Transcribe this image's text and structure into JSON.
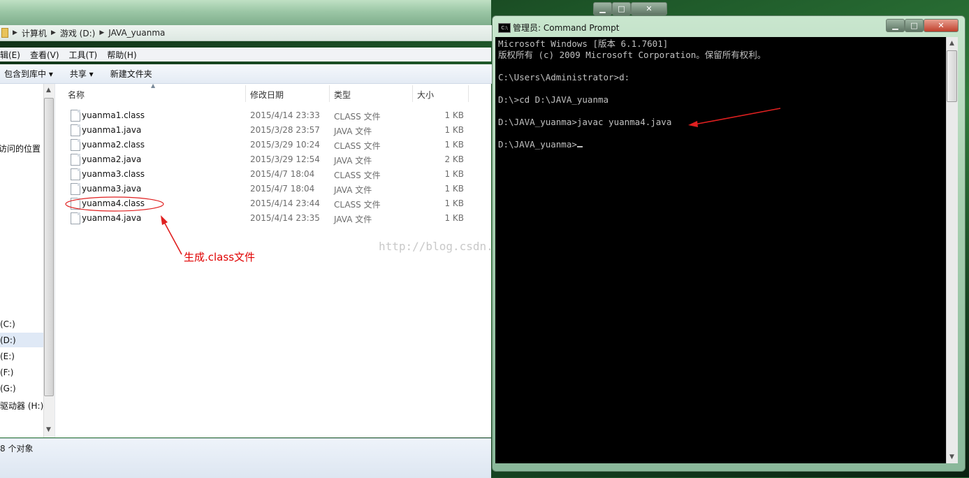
{
  "explorer": {
    "breadcrumb": [
      "计算机",
      "游戏 (D:)",
      "JAVA_yuanma"
    ],
    "menu": [
      "编辑(E)",
      "查看(V)",
      "工具(T)",
      "帮助(H)"
    ],
    "toolbar": [
      "包含到库中 ▾",
      "共享 ▾",
      "新建文件夹"
    ],
    "nav": {
      "recent": "访问的位置",
      "drive_c": "(C:)",
      "drive_d": "(D:)",
      "drive_e": "(E:)",
      "drive_f": "(F:)",
      "drive_g": "(G:)",
      "drive_h": "驱动器 (H:)"
    },
    "columns": {
      "name": "名称",
      "date": "修改日期",
      "type": "类型",
      "size": "大小"
    },
    "files": [
      {
        "name": "yuanma1.class",
        "date": "2015/4/14 23:33",
        "type": "CLASS 文件",
        "size": "1 KB"
      },
      {
        "name": "yuanma1.java",
        "date": "2015/3/28 23:57",
        "type": "JAVA 文件",
        "size": "1 KB"
      },
      {
        "name": "yuanma2.class",
        "date": "2015/3/29 10:24",
        "type": "CLASS 文件",
        "size": "1 KB"
      },
      {
        "name": "yuanma2.java",
        "date": "2015/3/29 12:54",
        "type": "JAVA 文件",
        "size": "2 KB"
      },
      {
        "name": "yuanma3.class",
        "date": "2015/4/7 18:04",
        "type": "CLASS 文件",
        "size": "1 KB"
      },
      {
        "name": "yuanma3.java",
        "date": "2015/4/7 18:04",
        "type": "JAVA 文件",
        "size": "1 KB"
      },
      {
        "name": "yuanma4.class",
        "date": "2015/4/14 23:44",
        "type": "CLASS 文件",
        "size": "1 KB"
      },
      {
        "name": "yuanma4.java",
        "date": "2015/4/14 23:35",
        "type": "JAVA 文件",
        "size": "1 KB"
      }
    ],
    "status": "8 个对象"
  },
  "annotation": {
    "text": "生成.class文件",
    "color": "#e00000"
  },
  "watermark": "http://blog.csdn.net/ThesCript_j",
  "cmd": {
    "title": "管理员: Command Prompt",
    "icon_label": "C:\\",
    "lines": [
      "Microsoft Windows [版本 6.1.7601]",
      "版权所有 (c) 2009 Microsoft Corporation。保留所有权利。",
      "",
      "C:\\Users\\Administrator>d:",
      "",
      "D:\\>cd D:\\JAVA_yuanma",
      "",
      "D:\\JAVA_yuanma>javac yuanma4.java",
      "",
      "D:\\JAVA_yuanma>"
    ]
  },
  "window_controls": {
    "minimize": "▁",
    "maximize": "□",
    "close": "✕"
  }
}
